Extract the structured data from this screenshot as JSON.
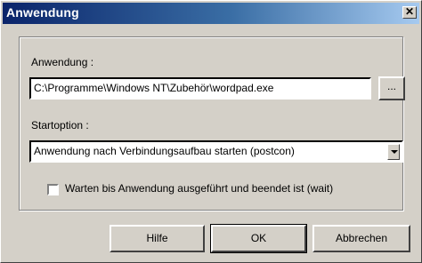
{
  "window": {
    "title": "Anwendung",
    "close_glyph": "✕"
  },
  "group": {
    "app_label": "Anwendung :",
    "app_path": "C:\\Programme\\Windows NT\\Zubehör\\wordpad.exe",
    "browse_label": "...",
    "startoption_label": "Startoption :",
    "startoption_value": "Anwendung nach Verbindungsaufbau starten  (postcon)",
    "wait_label": "Warten bis Anwendung ausgeführt und beendet ist  (wait)",
    "wait_checked": false
  },
  "buttons": {
    "help": "Hilfe",
    "ok": "OK",
    "cancel": "Abbrechen"
  },
  "icons": {
    "close": "close-icon",
    "dropdown": "chevron-down-icon",
    "checkbox": "checkbox-icon"
  },
  "colors": {
    "titlebar_start": "#0a246a",
    "titlebar_end": "#a6caf0",
    "window_bg": "#d4d0c8"
  }
}
